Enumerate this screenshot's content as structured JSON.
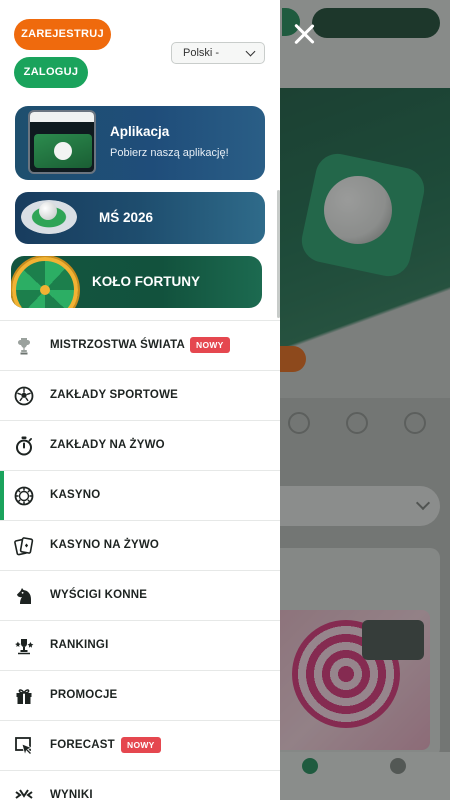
{
  "header": {
    "register_label": "ZAREJESTRUJ",
    "login_label": "ZALOGUJ",
    "language_value": "Polski -"
  },
  "promos": [
    {
      "title": "Aplikacja",
      "subtitle": "Pobierz naszą aplikację!"
    },
    {
      "title": "MŚ 2026"
    },
    {
      "title": "KOŁO FORTUNY"
    }
  ],
  "menu": [
    {
      "label": "MISTRZOSTWA ŚWIATA",
      "badge": "NOWY",
      "icon": "trophy-icon"
    },
    {
      "label": "ZAKŁADY SPORTOWE",
      "icon": "soccer-ball-icon"
    },
    {
      "label": "ZAKŁADY NA ŻYWO",
      "icon": "stopwatch-icon"
    },
    {
      "label": "KASYNO",
      "icon": "casino-chip-icon",
      "active": true
    },
    {
      "label": "KASYNO NA ŻYWO",
      "icon": "playing-cards-icon"
    },
    {
      "label": "WYŚCIGI KONNE",
      "icon": "horse-head-icon"
    },
    {
      "label": "RANKINGI",
      "icon": "ranking-trophy-icon"
    },
    {
      "label": "PROMOCJE",
      "icon": "gift-icon"
    },
    {
      "label": "FORECAST",
      "badge": "NOWY",
      "icon": "forecast-cursor-icon"
    },
    {
      "label": "WYNIKI",
      "icon": "results-icon"
    }
  ],
  "colors": {
    "accent_green": "#1aa35c",
    "accent_orange": "#ef6a0d",
    "badge_red": "#e5474f"
  }
}
